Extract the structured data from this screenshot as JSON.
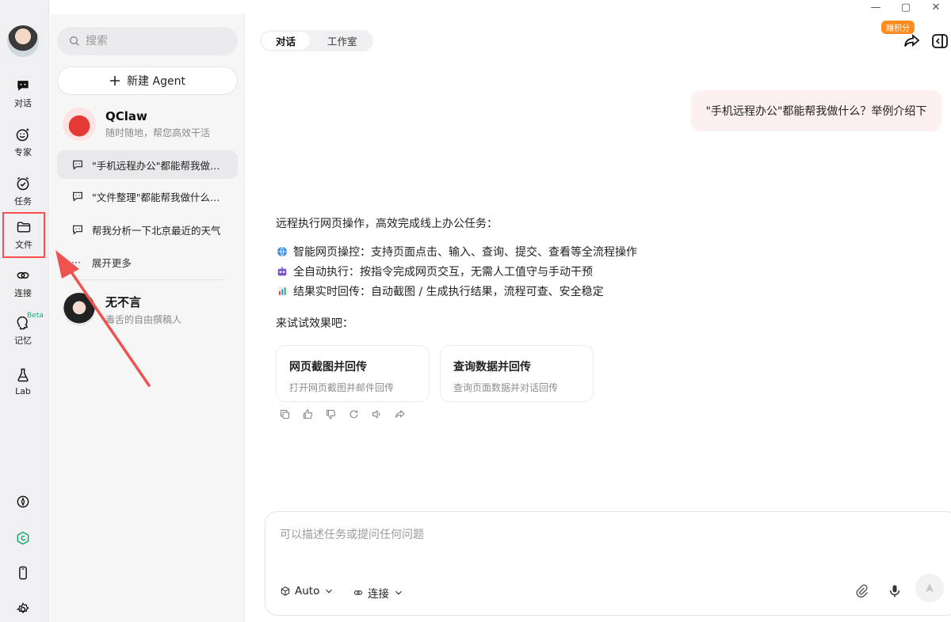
{
  "window": {
    "min": "—",
    "max": "▢",
    "close": "✕"
  },
  "rail": {
    "items": [
      {
        "label": "对话"
      },
      {
        "label": "专家"
      },
      {
        "label": "任务"
      },
      {
        "label": "文件"
      },
      {
        "label": "连接"
      },
      {
        "label": "记忆",
        "badge": "Beta"
      },
      {
        "label": "Lab"
      }
    ]
  },
  "sidebar": {
    "search_placeholder": "搜索",
    "new_agent": "新建 Agent",
    "agent1": {
      "name": "QClaw",
      "desc": "随时随地，帮您高效干活"
    },
    "chats": [
      "\"手机远程办公\"都能帮我做…",
      "\"文件整理\"都能帮我做什么…",
      "帮我分析一下北京最近的天气"
    ],
    "more": "展开更多",
    "more_icon": "···",
    "agent2": {
      "name": "无不言",
      "desc": "毒舌的自由撰稿人"
    }
  },
  "main": {
    "tabs": [
      "对话",
      "工作室"
    ],
    "badge": "赚积分",
    "user_message": "\"手机远程办公\"都能帮我做什么？举例介绍下",
    "answer": {
      "intro": "远程执行网页操作，高效完成线上办公任务：",
      "lines": [
        "智能网页操控：支持页面点击、输入、查询、提交、查看等全流程操作",
        "全自动执行：按指令完成网页交互，无需人工值守与手动干预",
        "结果实时回传：自动截图 / 生成执行结果，流程可查、安全稳定"
      ],
      "try": "来试试效果吧："
    },
    "cards": [
      {
        "title": "网页截图并回传",
        "desc": "打开网页截图并邮件回传"
      },
      {
        "title": "查询数据并回传",
        "desc": "查询页面数据并对话回传"
      }
    ],
    "composer": {
      "placeholder": "可以描述任务或提问任何问题",
      "model": "Auto",
      "connect": "连接"
    }
  },
  "colors": {
    "highlight": "#ff4d4f",
    "badge": "#ff8a1f",
    "bubble": "#fdf0f0"
  }
}
